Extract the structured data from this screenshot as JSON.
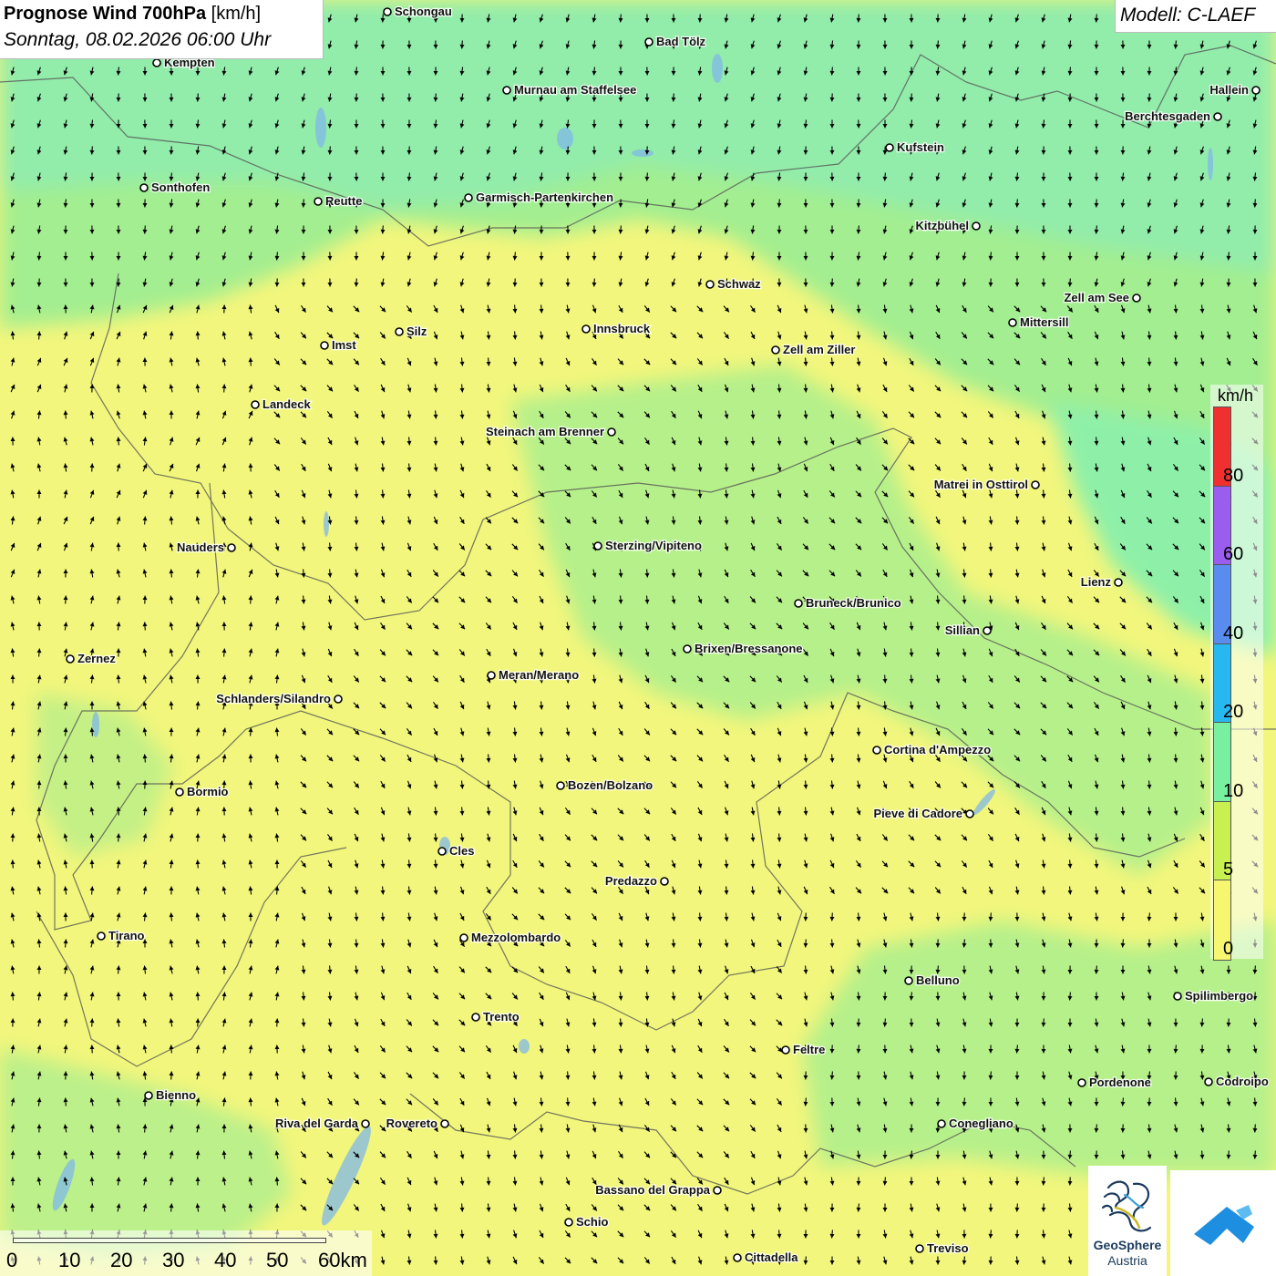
{
  "header": {
    "title_bold": "Prognose Wind 700hPa",
    "title_unit": "[km/h]",
    "datetime": "Sonntag, 08.02.2026 06:00 Uhr",
    "model": "Modell: C-LAEF"
  },
  "legend": {
    "unit": "km/h",
    "ticks": [
      "80",
      "60",
      "40",
      "20",
      "10",
      "5",
      "0"
    ],
    "colors": [
      "#f03030",
      "#9b5cf0",
      "#5a8cf0",
      "#28b8f0",
      "#78f0a0",
      "#c8f050",
      "#f6f670"
    ]
  },
  "scale": {
    "labels": [
      "0",
      "10",
      "20",
      "30",
      "40",
      "50",
      "60km"
    ]
  },
  "logos": {
    "geosphere_line1": "GeoSphere",
    "geosphere_line2": "Austria",
    "geosphere_icon": "geosphere-swirl-icon",
    "app_icon": "app-wind-icon"
  },
  "colors": {
    "calm_yellow": "#f2f67c",
    "light_green": "#a6f08e",
    "medium_green": "#8ef0a8"
  },
  "cities": [
    {
      "name": "Schongau"
    },
    {
      "name": "Bad Tölz"
    },
    {
      "name": "Kempten"
    },
    {
      "name": "Murnau am Staffelsee"
    },
    {
      "name": "Hallein"
    },
    {
      "name": "Berchtesgaden"
    },
    {
      "name": "Kufstein"
    },
    {
      "name": "Sonthofen"
    },
    {
      "name": "Reutte"
    },
    {
      "name": "Garmisch-Partenkirchen"
    },
    {
      "name": "Kitzbühel"
    },
    {
      "name": "Schwaz"
    },
    {
      "name": "Zell am See"
    },
    {
      "name": "Mittersill"
    },
    {
      "name": "Innsbruck"
    },
    {
      "name": "Silz"
    },
    {
      "name": "Imst"
    },
    {
      "name": "Zell am Ziller"
    },
    {
      "name": "Landeck"
    },
    {
      "name": "Steinach am Brenner"
    },
    {
      "name": "Matrei in Osttirol"
    },
    {
      "name": "Nauders"
    },
    {
      "name": "Sterzing/Vipiteno"
    },
    {
      "name": "Lienz"
    },
    {
      "name": "Bruneck/Brunico"
    },
    {
      "name": "Sillian"
    },
    {
      "name": "Brixen/Bressanone"
    },
    {
      "name": "Zernez"
    },
    {
      "name": "Meran/Merano"
    },
    {
      "name": "Schlanders/Silandro"
    },
    {
      "name": "Cortina d'Ampezzo"
    },
    {
      "name": "Bozen/Bolzano"
    },
    {
      "name": "Bormio"
    },
    {
      "name": "Pieve di Cadore"
    },
    {
      "name": "Cles"
    },
    {
      "name": "Predazzo"
    },
    {
      "name": "Tirano"
    },
    {
      "name": "Mezzolombardo"
    },
    {
      "name": "Belluno"
    },
    {
      "name": "Spilimbergo"
    },
    {
      "name": "Trento"
    },
    {
      "name": "Feltre"
    },
    {
      "name": "Bienno"
    },
    {
      "name": "Pordenone"
    },
    {
      "name": "Codroipo"
    },
    {
      "name": "Riva del Garda"
    },
    {
      "name": "Rovereto"
    },
    {
      "name": "Conegliano"
    },
    {
      "name": "Bassano del Grappa"
    },
    {
      "name": "Schio"
    },
    {
      "name": "Treviso"
    },
    {
      "name": "Cittadella"
    }
  ]
}
